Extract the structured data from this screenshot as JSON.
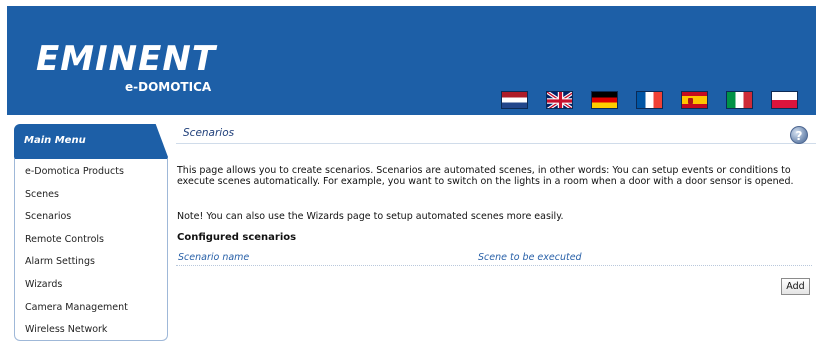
{
  "brand": {
    "name": "EMINENT",
    "subtitle": "e-DOMOTICA"
  },
  "languages": [
    {
      "icon": "flag-nl-icon",
      "colors": [
        "#ae1c28",
        "#ffffff",
        "#21468b"
      ]
    },
    {
      "icon": "flag-uk-icon",
      "colors": [
        "#012169",
        "#ffffff",
        "#c8102e"
      ]
    },
    {
      "icon": "flag-de-icon",
      "colors": [
        "#000000",
        "#dd0000",
        "#ffce00"
      ]
    },
    {
      "icon": "flag-fr-icon",
      "colors": [
        "#0055a4",
        "#ffffff",
        "#ef4135"
      ]
    },
    {
      "icon": "flag-es-icon",
      "colors": [
        "#c60b1e",
        "#ffc400",
        "#c60b1e"
      ]
    },
    {
      "icon": "flag-it-icon",
      "colors": [
        "#009246",
        "#ffffff",
        "#ce2b37"
      ]
    },
    {
      "icon": "flag-pl-icon",
      "colors": [
        "#ffffff",
        "#dc143c"
      ]
    }
  ],
  "sidebar": {
    "title": "Main Menu",
    "items": [
      {
        "label": "e-Domotica Products"
      },
      {
        "label": "Scenes"
      },
      {
        "label": "Scenarios"
      },
      {
        "label": "Remote Controls"
      },
      {
        "label": "Alarm Settings"
      },
      {
        "label": "Wizards"
      },
      {
        "label": "Camera Management"
      },
      {
        "label": "Wireless Network"
      }
    ]
  },
  "page": {
    "title": "Scenarios",
    "help_icon": "?",
    "description": "This page allows you to create scenarios. Scenarios are automated scenes, in other words: You can setup events or conditions to execute scenes automatically. For example, you want to switch on the lights in a room when a door with a door sensor is opened.",
    "note": "Note! You can also use the Wizards page to setup automated scenes more easily.",
    "section_title": "Configured scenarios",
    "table": {
      "columns": [
        "Scenario name",
        "Scene to be executed"
      ],
      "rows": []
    },
    "add_label": "Add"
  },
  "colors": {
    "header_blue": "#1d5fa7",
    "link_blue": "#2860a8"
  }
}
